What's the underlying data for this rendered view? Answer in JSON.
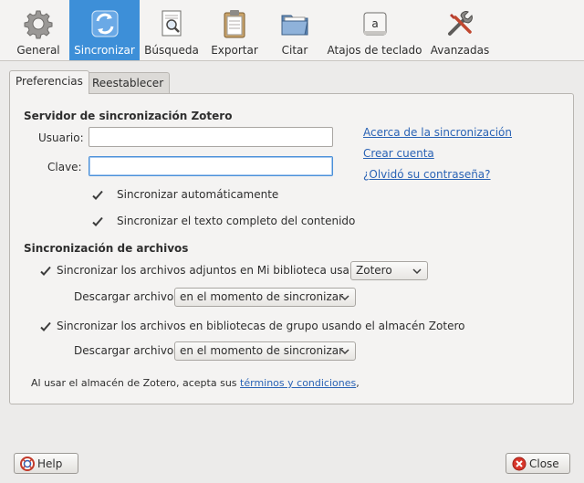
{
  "toolbar": {
    "items": [
      {
        "label": "General",
        "icon": "gear-icon"
      },
      {
        "label": "Sincronizar",
        "icon": "sync-icon"
      },
      {
        "label": "Búsqueda",
        "icon": "search-document-icon"
      },
      {
        "label": "Exportar",
        "icon": "clipboard-icon"
      },
      {
        "label": "Citar",
        "icon": "folder-icon"
      },
      {
        "label": "Atajos de teclado",
        "icon": "keyboard-key-icon",
        "key_glyph": "a"
      },
      {
        "label": "Avanzadas",
        "icon": "tools-icon"
      }
    ],
    "active_index": 1
  },
  "tabs": [
    {
      "label": "Preferencias",
      "active": true
    },
    {
      "label": "Reestablecer",
      "active": false
    }
  ],
  "server": {
    "heading": "Servidor de sincronización Zotero",
    "user_label": "Usuario:",
    "user_value": "",
    "password_label": "Clave:",
    "password_value": "",
    "auto_sync": {
      "label": "Sincronizar automáticamente",
      "checked": true
    },
    "fulltext_sync": {
      "label": "Sincronizar el texto completo del contenido",
      "checked": true
    },
    "links": {
      "about": "Acerca de la sincronización",
      "create_account": "Crear cuenta",
      "forgot_password": "¿Olvidó su contraseña?"
    }
  },
  "files": {
    "heading": "Sincronización de archivos",
    "my_library": {
      "label": "Sincronizar los archivos adjuntos en Mi biblioteca usando",
      "checked": true,
      "method": "Zotero",
      "download_label": "Descargar archivos",
      "download_value": "en el momento de sincronizar"
    },
    "group_libraries": {
      "label": "Sincronizar los archivos en bibliotecas de grupo usando el almacén Zotero",
      "checked": true,
      "download_label": "Descargar archivos",
      "download_value": "en el momento de sincronizar"
    },
    "terms_text": "Al usar el almacén de Zotero, acepta sus",
    "terms_link": "términos y condiciones",
    "terms_suffix": ","
  },
  "buttons": {
    "help": "Help",
    "close": "Close"
  },
  "colors": {
    "accent": "#3d8fd8",
    "link": "#2a63b5"
  }
}
